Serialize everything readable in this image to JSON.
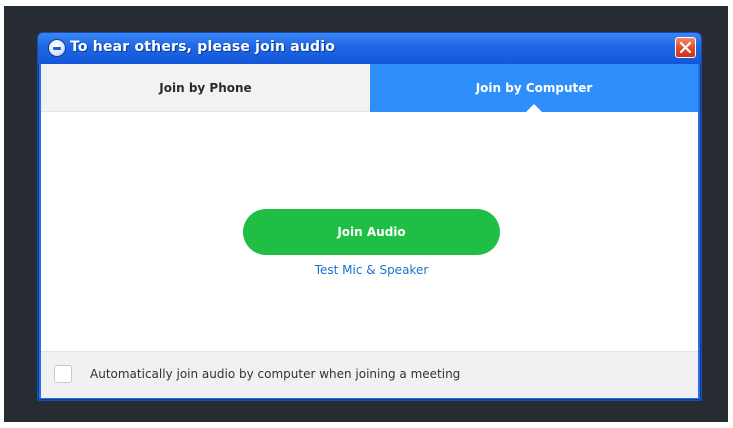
{
  "window": {
    "title": "To hear others, please join audio"
  },
  "tabs": [
    {
      "label": "Join by Phone",
      "active": false
    },
    {
      "label": "Join by Computer",
      "active": true
    }
  ],
  "main": {
    "join_audio_label": "Join Audio",
    "test_link_label": "Test Mic & Speaker"
  },
  "footer": {
    "checkbox_checked": false,
    "checkbox_label": "Automatically join audio by computer when joining a meeting"
  },
  "colors": {
    "titlebar": "#1f66e3",
    "active_tab": "#2f8ffa",
    "join_button": "#1fbf45",
    "link": "#1a73c9",
    "close_button": "#df4a2a"
  },
  "icons": {
    "title": "audio-app-icon",
    "close": "close-icon"
  }
}
